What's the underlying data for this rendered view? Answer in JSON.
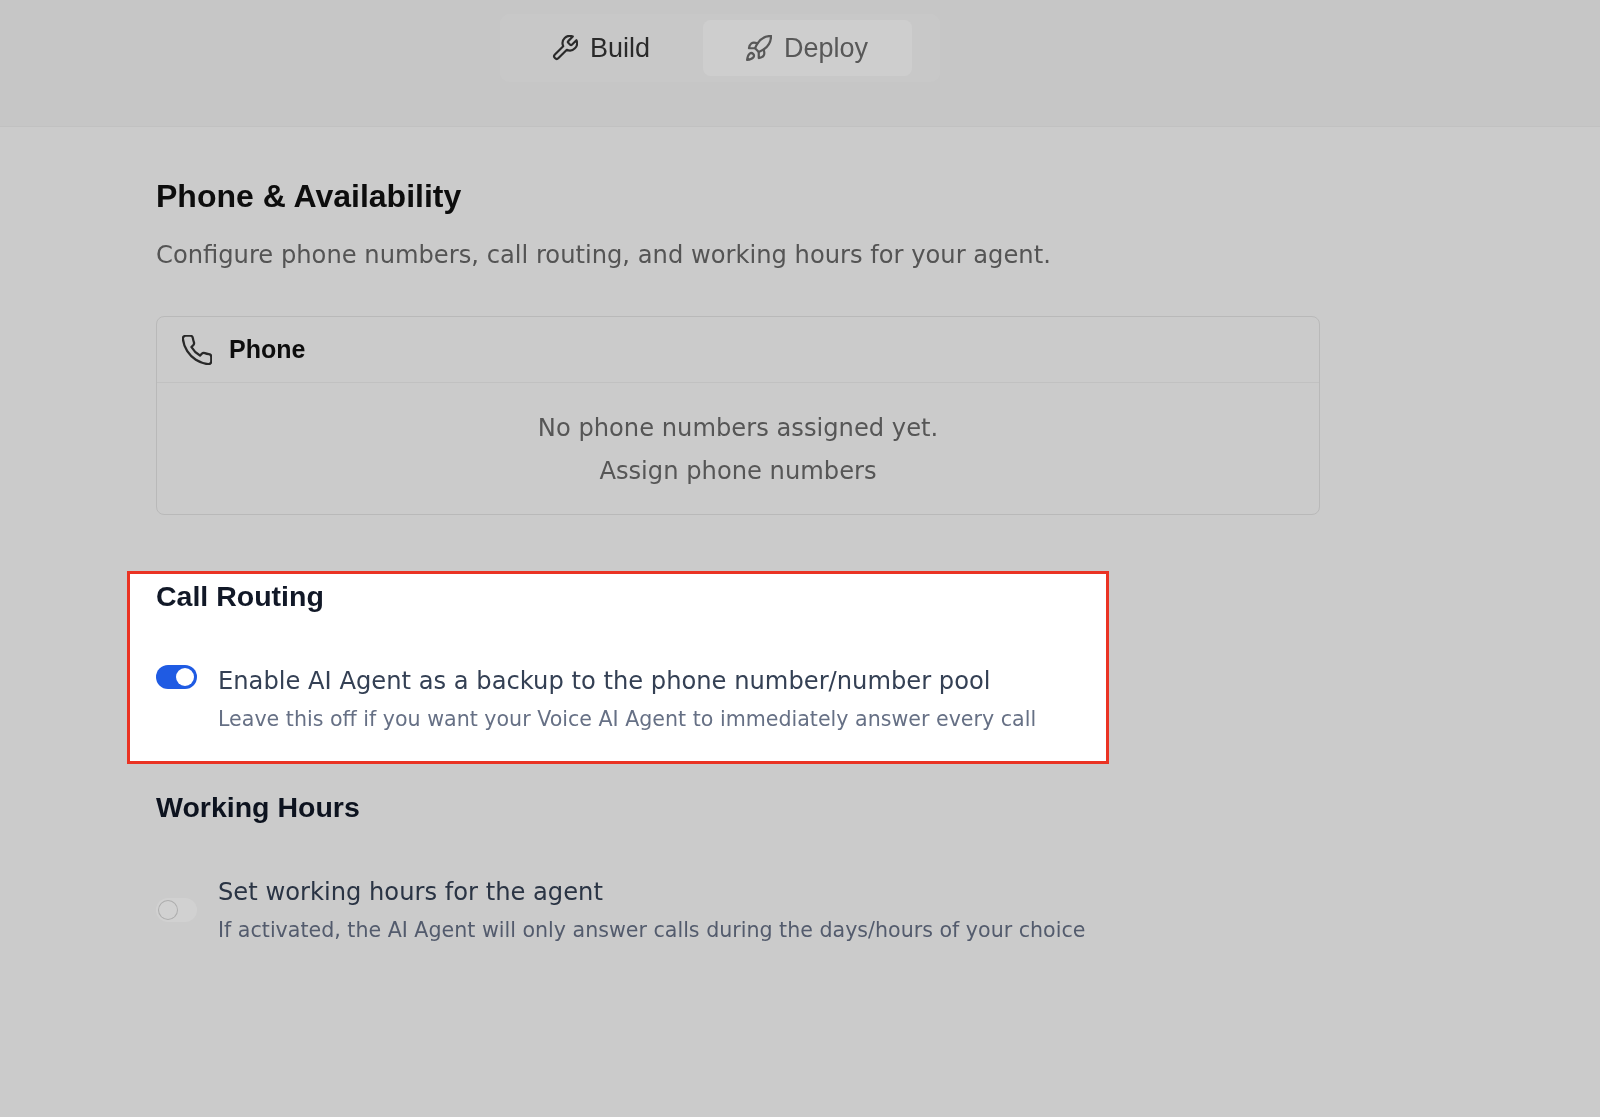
{
  "top_bar": {
    "tabs": [
      {
        "label": "Build",
        "selected": false
      },
      {
        "label": "Deploy",
        "selected": true
      }
    ]
  },
  "page": {
    "title": "Phone & Availability",
    "subtitle": "Configure phone numbers, call routing, and working hours for your agent."
  },
  "phone_card": {
    "title": "Phone",
    "empty_message": "No phone numbers assigned yet.",
    "link": "Assign phone numbers"
  },
  "sections": [
    {
      "highlighted": true,
      "title": "Call Routing",
      "setting": {
        "on": true,
        "label": "Enable AI Agent as a backup to the phone number/number pool",
        "hint": "Leave this off if you want your Voice AI Agent to immediately answer every call"
      }
    },
    {
      "highlighted": false,
      "title": "Working Hours",
      "setting": {
        "on": false,
        "label": "Set working hours for the agent",
        "hint": "If activated, the AI Agent will only answer calls during the days/hours of your choice"
      }
    }
  ]
}
